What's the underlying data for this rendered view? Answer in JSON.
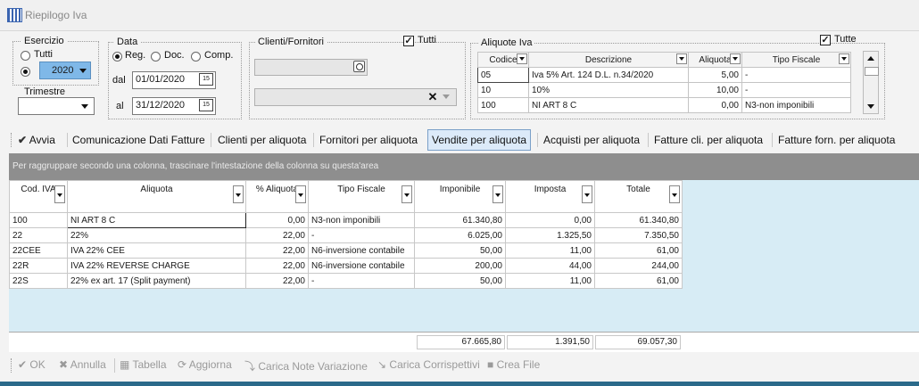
{
  "window": {
    "title": "Riepilogo Iva"
  },
  "esercizio": {
    "legend": "Esercizio",
    "opt_tutti": "Tutti",
    "year": "2020"
  },
  "trimestre": {
    "legend": "Trimestre",
    "value": ""
  },
  "data": {
    "legend": "Data",
    "opt_reg": "Reg.",
    "opt_doc": "Doc.",
    "opt_comp": "Comp.",
    "dal_label": "dal",
    "al_label": "al",
    "dal_value": "01/01/2020",
    "al_value": "31/12/2020"
  },
  "clienti": {
    "legend": "Clienti/Fornitori",
    "tutti_label": "Tutti",
    "tutti_checked": "✓"
  },
  "aliquote": {
    "legend": "Aliquote Iva",
    "tutte_label": "Tutte",
    "tutte_checked": "✓",
    "headers": [
      "Codice",
      "Descrizione",
      "Aliquota",
      "Tipo Fiscale"
    ],
    "rows": [
      [
        "05",
        "Iva 5% Art. 124 D.L. n.34/2020",
        "5,00",
        "-"
      ],
      [
        "10",
        "10%",
        "10,00",
        "-"
      ],
      [
        "100",
        "NI ART 8 C",
        "0,00",
        "N3-non imponibili"
      ]
    ]
  },
  "tabs": {
    "avvia": "Avvia",
    "items": [
      "Comunicazione Dati Fatture",
      "Clienti per aliquota",
      "Fornitori per aliquota",
      "Vendite per aliquota",
      "Acquisti per aliquota",
      "Fatture cli. per aliquota",
      "Fatture forn. per aliquota"
    ]
  },
  "grid": {
    "group_hint": "Per raggruppare secondo una colonna, trascinare l'intestazione della colonna su questa'area",
    "headers": [
      "Cod. IVA",
      "Aliquota",
      "% Aliquota",
      "Tipo Fiscale",
      "Imponibile",
      "Imposta",
      "Totale"
    ],
    "rows": [
      [
        "100",
        "NI ART 8 C",
        "0,00",
        "N3-non imponibili",
        "61.340,80",
        "0,00",
        "61.340,80"
      ],
      [
        "22",
        "22%",
        "22,00",
        "-",
        "6.025,00",
        "1.325,50",
        "7.350,50"
      ],
      [
        "22CEE",
        "IVA 22% CEE",
        "22,00",
        "N6-inversione contabile",
        "50,00",
        "11,00",
        "61,00"
      ],
      [
        "22R",
        "IVA 22% REVERSE CHARGE",
        "22,00",
        "N6-inversione contabile",
        "200,00",
        "44,00",
        "244,00"
      ],
      [
        "22S",
        "22% ex art. 17 (Split payment)",
        "22,00",
        "-",
        "50,00",
        "11,00",
        "61,00"
      ]
    ],
    "totals": {
      "imponibile": "67.665,80",
      "imposta": "1.391,50",
      "totale": "69.057,30"
    }
  },
  "buttons": {
    "ok": "OK",
    "annulla": "Annulla",
    "tabella": "Tabella",
    "aggiorna": "Aggiorna",
    "carica_note": "Carica Note Variazione",
    "carica_corr": "Carica Corrispettivi",
    "crea_file": "Crea File"
  },
  "colors": {
    "accent_blue": "#7fb8e8",
    "grid_bg": "#d7ecf5",
    "group_header": "#8e8e8e",
    "active_tab": "#dceaf9"
  }
}
